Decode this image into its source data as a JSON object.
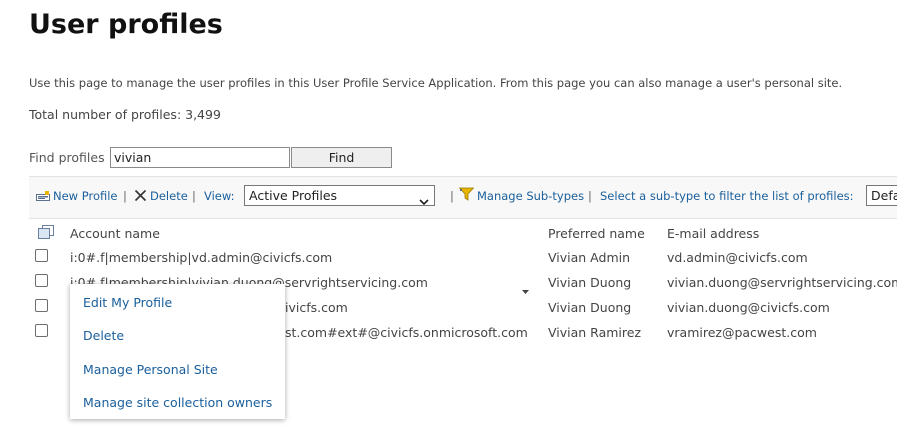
{
  "page": {
    "title": "User profiles",
    "description": "Use this page to manage the user profiles in this User Profile Service Application. From this page you can also manage a user's personal site.",
    "total_profiles": "Total number of profiles: 3,499"
  },
  "find": {
    "label": "Find profiles",
    "value": "vivian",
    "button": "Find"
  },
  "toolbar": {
    "new_profile": "New Profile",
    "delete": "Delete",
    "view_label": "View:",
    "view_selected": "Active Profiles",
    "manage_subtypes": "Manage Sub-types",
    "subtype_prompt": "Select a sub-type to filter the list of profiles:",
    "subtype_selected": "Default",
    "separator": "|"
  },
  "table": {
    "columns": [
      "Account name",
      "Preferred name",
      "E-mail address"
    ],
    "rows": [
      {
        "account": "i:0#.f|membership|vd.admin@civicfs.com",
        "preferred": "Vivian Admin",
        "email": "vd.admin@civicfs.com"
      },
      {
        "account": "i:0#.f|membership|vivian.duong@servrightservicing.com",
        "preferred": "Vivian Duong",
        "email": "vivian.duong@servrightservicing.com"
      },
      {
        "account": "ivicfs.com",
        "preferred": "Vivian Duong",
        "email": "vivian.duong@civicfs.com"
      },
      {
        "account": "st.com#ext#@civicfs.onmicrosoft.com",
        "preferred": "Vivian Ramirez",
        "email": "vramirez@pacwest.com"
      }
    ]
  },
  "context_menu": {
    "items": [
      "Edit My Profile",
      "Delete",
      "Manage Personal Site",
      "Manage site collection owners"
    ]
  },
  "colors": {
    "link": "#1a5f9c",
    "text": "#444444",
    "toolbar_bg": "#f8f8f8"
  },
  "icons": [
    "new-profile-icon",
    "delete-x-icon",
    "manage-subtypes-icon",
    "select-all-icon",
    "chevron-down-icon",
    "row-menu-arrow-icon"
  ]
}
